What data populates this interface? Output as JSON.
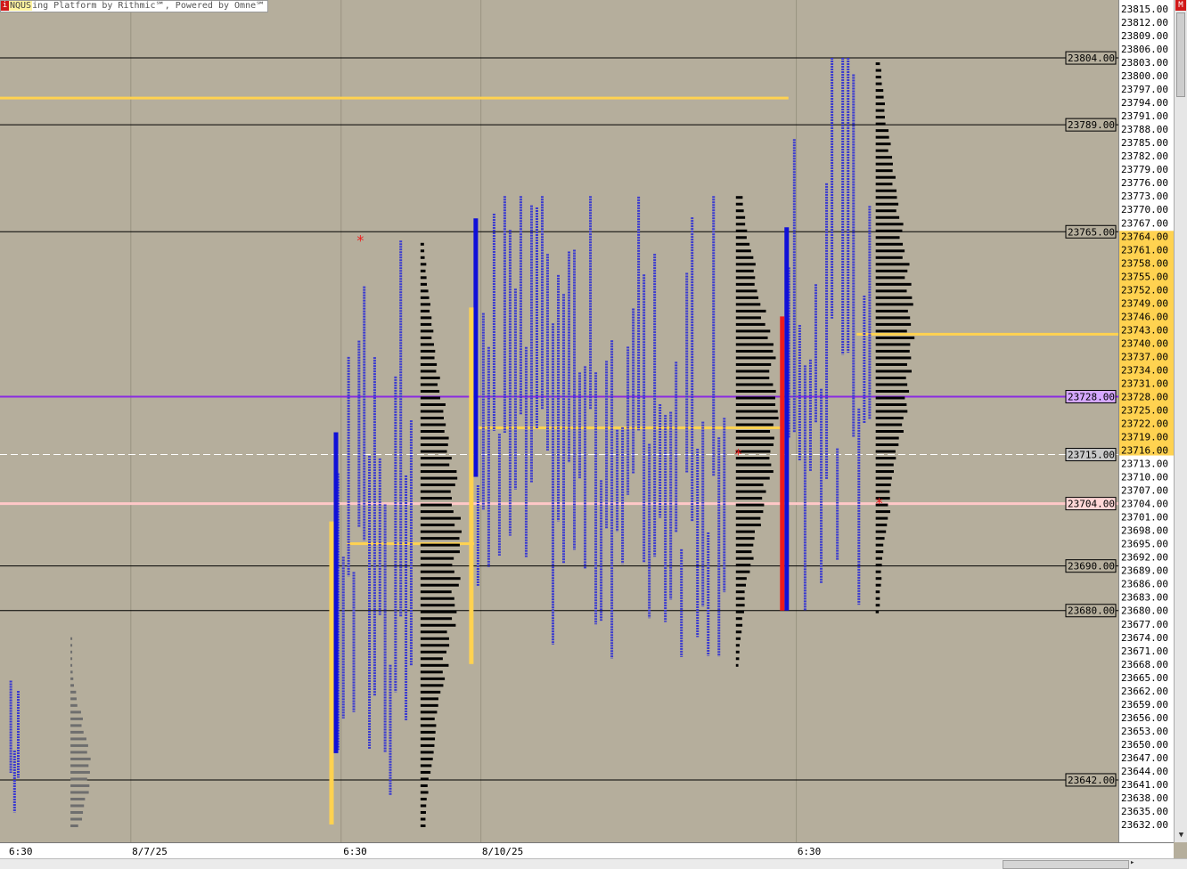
{
  "title_bar": {
    "close_glyph": "i",
    "symbol": "NQUS",
    "text": "ing Platform by Rithmic℠, Powered by Omne℠"
  },
  "scroll": {
    "close_glyph": "M",
    "down_glyph": "▼",
    "right_glyph": "▸"
  },
  "colors": {
    "background": "#b5ae9c",
    "tpo_blue": "#3a3ad0",
    "profile_black": "#000000",
    "profile_gray": "#6e6e6e",
    "poc_yellow": "#ffd250",
    "va_purple": "#8a2be2",
    "ib_red": "#ee1c1c",
    "ib_blue": "#1010d8",
    "pink_line": "#ffc8c8",
    "volume_green": "#c8f0c0"
  },
  "chart_data": {
    "type": "market-profile",
    "symbol": "NQUS",
    "price_axis": {
      "min": 23632.0,
      "max": 23815.0,
      "tick_step": 3,
      "ticks": [
        "23815.00",
        "23812.00",
        "23809.00",
        "23806.00",
        "23803.00",
        "23800.00",
        "23797.00",
        "23794.00",
        "23791.00",
        "23788.00",
        "23785.00",
        "23782.00",
        "23779.00",
        "23776.00",
        "23773.00",
        "23770.00",
        "23767.00",
        "23764.00",
        "23761.00",
        "23758.00",
        "23755.00",
        "23752.00",
        "23749.00",
        "23746.00",
        "23743.00",
        "23740.00",
        "23737.00",
        "23734.00",
        "23731.00",
        "23728.00",
        "23725.00",
        "23722.00",
        "23719.00",
        "23716.00",
        "23713.00",
        "23710.00",
        "23707.00",
        "23704.00",
        "23701.00",
        "23698.00",
        "23695.00",
        "23692.00",
        "23689.00",
        "23686.00",
        "23683.00",
        "23680.00",
        "23677.00",
        "23674.00",
        "23671.00",
        "23668.00",
        "23665.00",
        "23662.00",
        "23659.00",
        "23656.00",
        "23653.00",
        "23650.00",
        "23647.00",
        "23644.00",
        "23641.00",
        "23638.00",
        "23635.00",
        "23632.00"
      ],
      "highlight_range": [
        23716.0,
        23764.0
      ]
    },
    "time_axis": {
      "labels": [
        "6:30",
        "8/7/25",
        "6:30",
        "8/10/25",
        "6:30"
      ]
    },
    "horizontal_levels": [
      {
        "price": 23804.0,
        "label": "23804.00",
        "style": "black"
      },
      {
        "price": 23789.0,
        "label": "23789.00",
        "style": "black"
      },
      {
        "price": 23765.0,
        "label": "23765.00",
        "style": "black"
      },
      {
        "price": 23728.0,
        "label": "23728.00",
        "style": "purple"
      },
      {
        "price": 23715.0,
        "label": "23715.00",
        "style": "dashed"
      },
      {
        "price": 23704.0,
        "label": "23704.00",
        "style": "pink"
      },
      {
        "price": 23690.0,
        "label": "23690.00",
        "style": "black"
      },
      {
        "price": 23680.0,
        "label": "23680.00",
        "style": "black"
      },
      {
        "price": 23642.0,
        "label": "23642.00",
        "style": "black"
      }
    ],
    "yellow_levels": [
      {
        "price": 23795.0,
        "from": 0.0,
        "to": 0.705
      },
      {
        "price": 23742.0,
        "from": 0.766,
        "to": 1.0
      },
      {
        "price": 23721.0,
        "from": 0.428,
        "to": 0.7
      },
      {
        "price": 23695.0,
        "from": 0.31,
        "to": 0.424
      }
    ],
    "sessions": [
      {
        "id": "s1",
        "tpo_from": 0.008,
        "tpo_to": 0.018,
        "low": 23632.0,
        "high": 23675.0,
        "profile_from": 0.063,
        "profile_low": 23632.0,
        "profile_high": 23675.0,
        "profile_peak": 23645.0,
        "profile_max": 0.02,
        "profile_color": "gray"
      },
      {
        "id": "s2",
        "tpo_from": 0.3,
        "tpo_to": 0.37,
        "low": 23632.0,
        "high": 23763.0,
        "ib_low": 23648.0,
        "ib_high": 23720.0,
        "poc": 23695.0,
        "profile_from": 0.376,
        "profile_low": 23632.0,
        "profile_high": 23763.0,
        "profile_peak": 23696.0,
        "profile_max": 0.038,
        "profile_color": "black"
      },
      {
        "id": "s3",
        "tpo_from": 0.425,
        "tpo_to": 0.65,
        "low": 23668.0,
        "high": 23773.0,
        "ib_low": 23710.0,
        "ib_high": 23768.0,
        "poc": 23721.0,
        "profile_from": 0.658,
        "profile_low": 23668.0,
        "profile_high": 23773.0,
        "profile_peak": 23726.0,
        "profile_max": 0.04,
        "profile_color": "black"
      },
      {
        "id": "s4",
        "tpo_from": 0.703,
        "tpo_to": 0.78,
        "low": 23680.0,
        "high": 23804.0,
        "ib_low": 23680.0,
        "ib_high": 23766.0,
        "poc": 23742.0,
        "profile_from": 0.783,
        "profile_low": 23680.0,
        "profile_high": 23803.0,
        "profile_peak": 23744.0,
        "profile_max": 0.036,
        "profile_color": "black"
      }
    ],
    "markers": [
      {
        "x": 0.319,
        "price": 23763.0,
        "glyph": "*"
      },
      {
        "x": 0.657,
        "price": 23715.0,
        "glyph": "*"
      },
      {
        "x": 0.783,
        "price": 23704.0,
        "glyph": "*"
      }
    ]
  }
}
